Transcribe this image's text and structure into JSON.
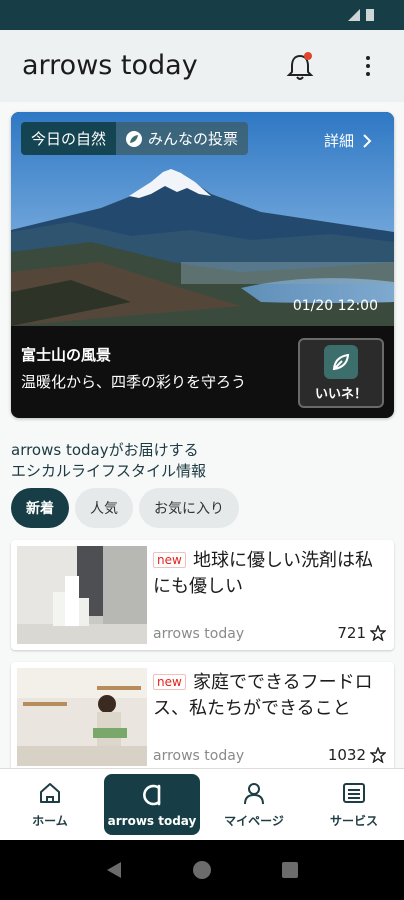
{
  "app": {
    "title": "arrows today"
  },
  "hero": {
    "tab_active": "今日の自然",
    "tab_other": "みんなの投票",
    "detail_label": "詳細",
    "timestamp": "01/20 12:00",
    "title": "富士山の風景",
    "subtitle": "温暖化から、四季の彩りを守ろう",
    "like_label": "いいネ！"
  },
  "section": {
    "line1": "arrows todayがお届けする",
    "line2": "エシカルライフスタイル情報"
  },
  "filters": [
    {
      "label": "新着",
      "active": true
    },
    {
      "label": "人気",
      "active": false
    },
    {
      "label": "お気に入り",
      "active": false
    }
  ],
  "articles": [
    {
      "badge": "new",
      "title": "地球に優しい洗剤は私にも優しい",
      "source": "arrows today",
      "count": "721"
    },
    {
      "badge": "new",
      "title": "家庭でできるフードロス、私たちができること",
      "source": "arrows today",
      "count": "1032"
    }
  ],
  "bottom_nav": [
    {
      "label": "ホーム",
      "icon": "home-icon"
    },
    {
      "label": "arrows today",
      "icon": "arrows-logo-icon"
    },
    {
      "label": "マイページ",
      "icon": "person-icon"
    },
    {
      "label": "サービス",
      "icon": "service-list-icon"
    }
  ],
  "colors": {
    "primary": "#173e46",
    "accent_red": "#e2231a",
    "like_green": "#3c6f6b"
  }
}
